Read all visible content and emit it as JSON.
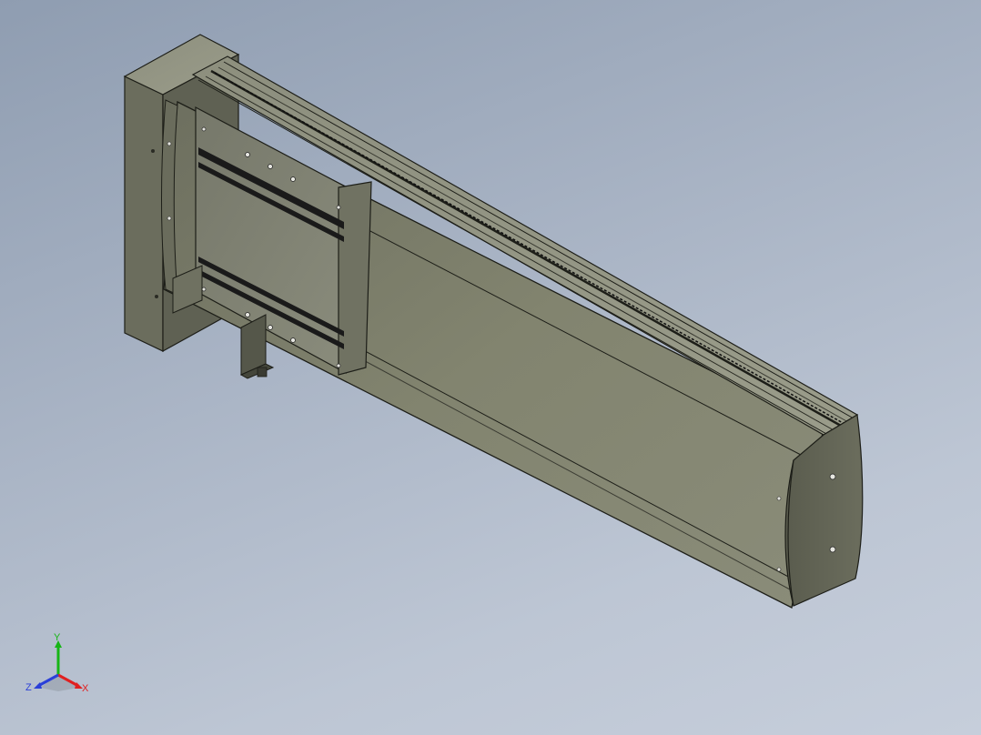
{
  "viewport": {
    "background_top": "#8f9db1",
    "background_bottom": "#c6cedb"
  },
  "model": {
    "body_color": "#7f816f",
    "edge_color": "#1d1e18",
    "shadow_color": "#5c5e50",
    "slot_color": "#1a1a1a"
  },
  "triad": {
    "x_label": "X",
    "y_label": "Y",
    "z_label": "Z",
    "x_color": "#e02020",
    "y_color": "#16b516",
    "z_color": "#2a3fd8"
  }
}
